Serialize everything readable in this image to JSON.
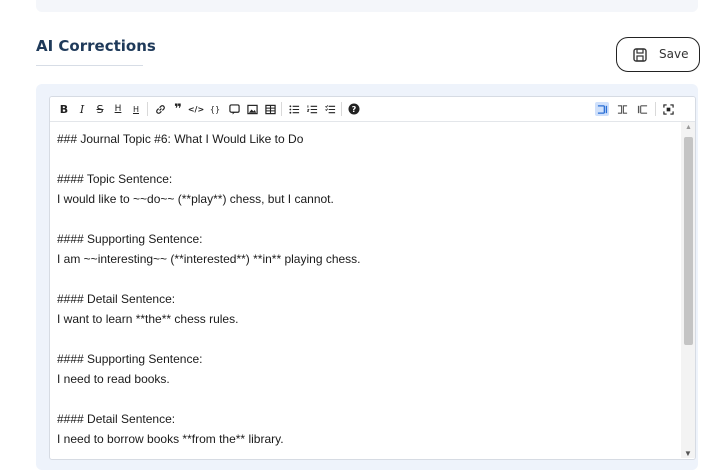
{
  "section": {
    "title": "AI Corrections"
  },
  "save": {
    "label": "Save"
  },
  "toolbar": {
    "buttons": [
      {
        "name": "bold-button",
        "glyph": "B"
      },
      {
        "name": "italic-button",
        "glyph": "I"
      },
      {
        "name": "strikethrough-button",
        "glyph": "S"
      },
      {
        "name": "heading-button",
        "glyph": "H"
      },
      {
        "name": "heading-smaller-button",
        "glyph": "H"
      },
      {
        "name": "link-button",
        "glyph": "🔗"
      },
      {
        "name": "quote-button",
        "glyph": "❞"
      },
      {
        "name": "code-button",
        "glyph": "</>"
      },
      {
        "name": "code-block-button",
        "glyph": "{}"
      },
      {
        "name": "comment-button",
        "glyph": "▣"
      },
      {
        "name": "image-button",
        "glyph": "▨"
      },
      {
        "name": "table-button",
        "glyph": "▦"
      },
      {
        "name": "bullet-list-button",
        "glyph": "≡"
      },
      {
        "name": "ordered-list-button",
        "glyph": "≡"
      },
      {
        "name": "checklist-button",
        "glyph": "≡"
      },
      {
        "name": "help-button",
        "glyph": "?"
      }
    ]
  },
  "content": {
    "lines": [
      "### Journal Topic #6: What I Would Like to Do",
      "",
      "#### Topic Sentence:",
      "I would like to ~~do~~ (**play**) chess, but I cannot.",
      "",
      "#### Supporting Sentence:",
      "I am ~~interesting~~ (**interested**) **in** playing chess.",
      "",
      "#### Detail Sentence:",
      "I want to learn **the** chess rules.",
      "",
      "#### Supporting Sentence:",
      "I need to read books.",
      "",
      "#### Detail Sentence:",
      "I need to borrow books **from the** library."
    ]
  }
}
